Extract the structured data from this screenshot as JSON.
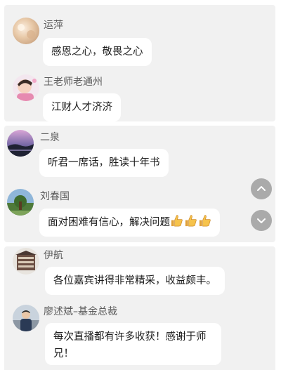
{
  "messages": [
    {
      "name": "运萍",
      "text": "感恩之心，敬畏之心"
    },
    {
      "name": "王老师老通州",
      "text": "江财人才济济"
    },
    {
      "name": "二泉",
      "text": "听君一席话，胜读十年书"
    },
    {
      "name": "刘春国",
      "text": "面对困难有信心，解决问题",
      "emoji": "thumbs-up x3"
    },
    {
      "name": "伊航",
      "text": "各位嘉宾讲得非常精采，收益颇丰。"
    },
    {
      "name": "廖述斌–基金总裁",
      "text": "每次直播都有许多收获！感谢于师兄！"
    }
  ],
  "controls": {
    "scroll_up_icon": "chevron-up-icon",
    "scroll_down_icon": "chevron-down-icon"
  },
  "colors": {
    "panel_bg": "#f1f1f1",
    "bubble_bg": "#ffffff",
    "name_text": "#5b5b5b",
    "fab_bg": "#aaaaaa"
  }
}
